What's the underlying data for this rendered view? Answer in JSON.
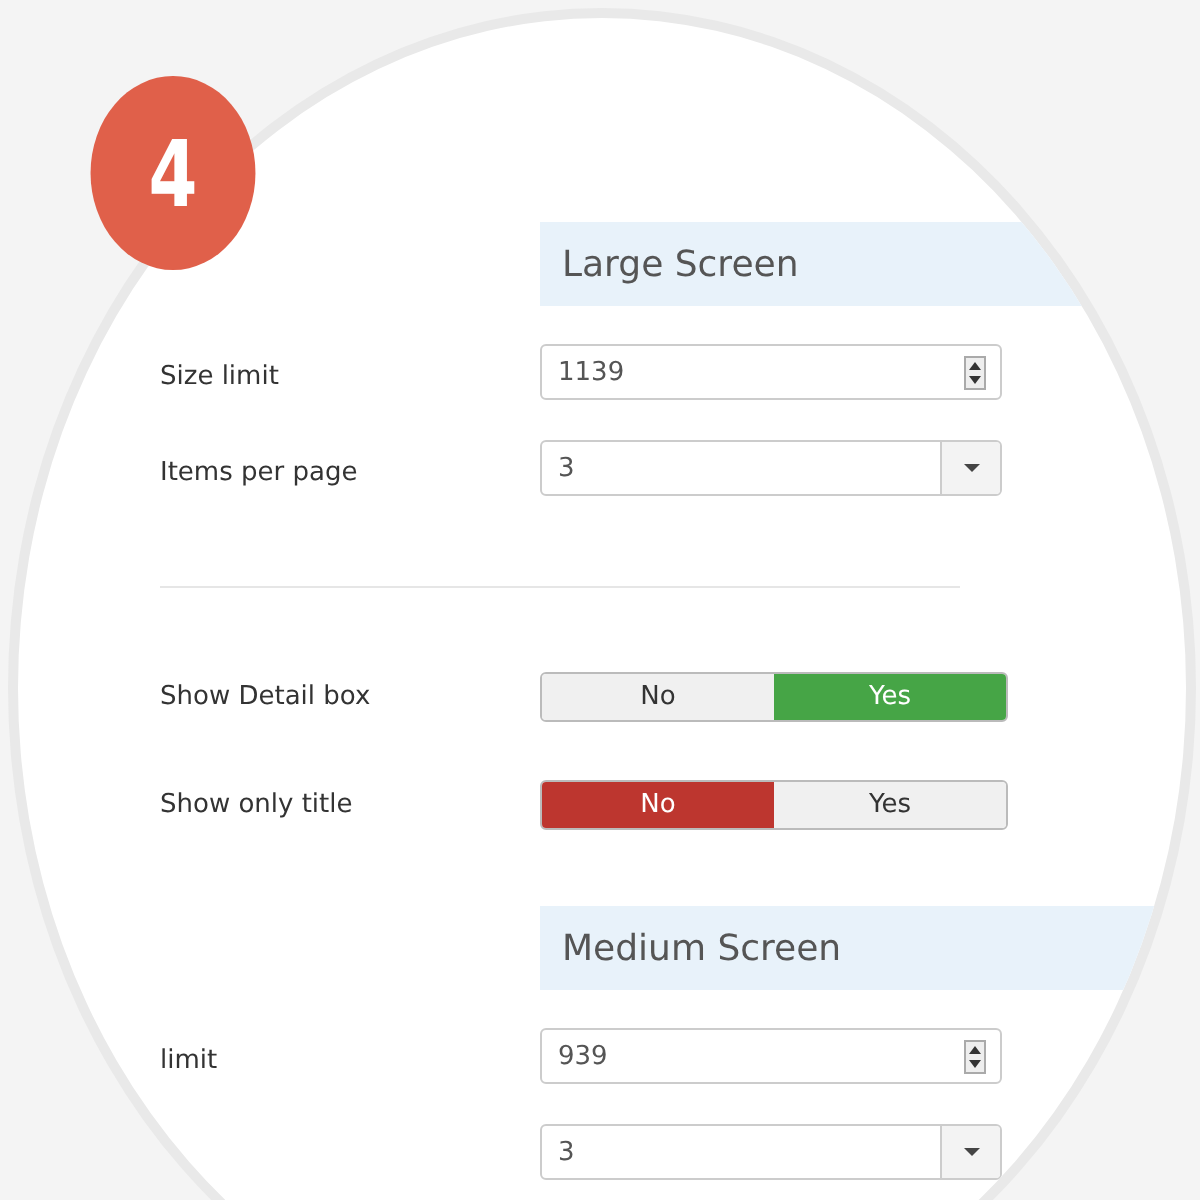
{
  "badge": "4",
  "sections": [
    {
      "title": "Large Screen",
      "rows": [
        {
          "kind": "number",
          "label": "Size limit",
          "value": "1139"
        },
        {
          "kind": "select",
          "label": "Items per page",
          "value": "3"
        },
        {
          "kind": "divider"
        },
        {
          "kind": "toggle",
          "label": "Show Detail box",
          "options": [
            {
              "label": "No",
              "selected": false
            },
            {
              "label": "Yes",
              "selected": true
            }
          ]
        },
        {
          "kind": "toggle",
          "label": "Show only title",
          "options": [
            {
              "label": "No",
              "selected": true
            },
            {
              "label": "Yes",
              "selected": false
            }
          ]
        }
      ]
    },
    {
      "title": "Medium Screen",
      "rows": [
        {
          "kind": "number",
          "label": "limit",
          "value": "939"
        },
        {
          "kind": "select",
          "value": "3"
        }
      ]
    }
  ]
}
